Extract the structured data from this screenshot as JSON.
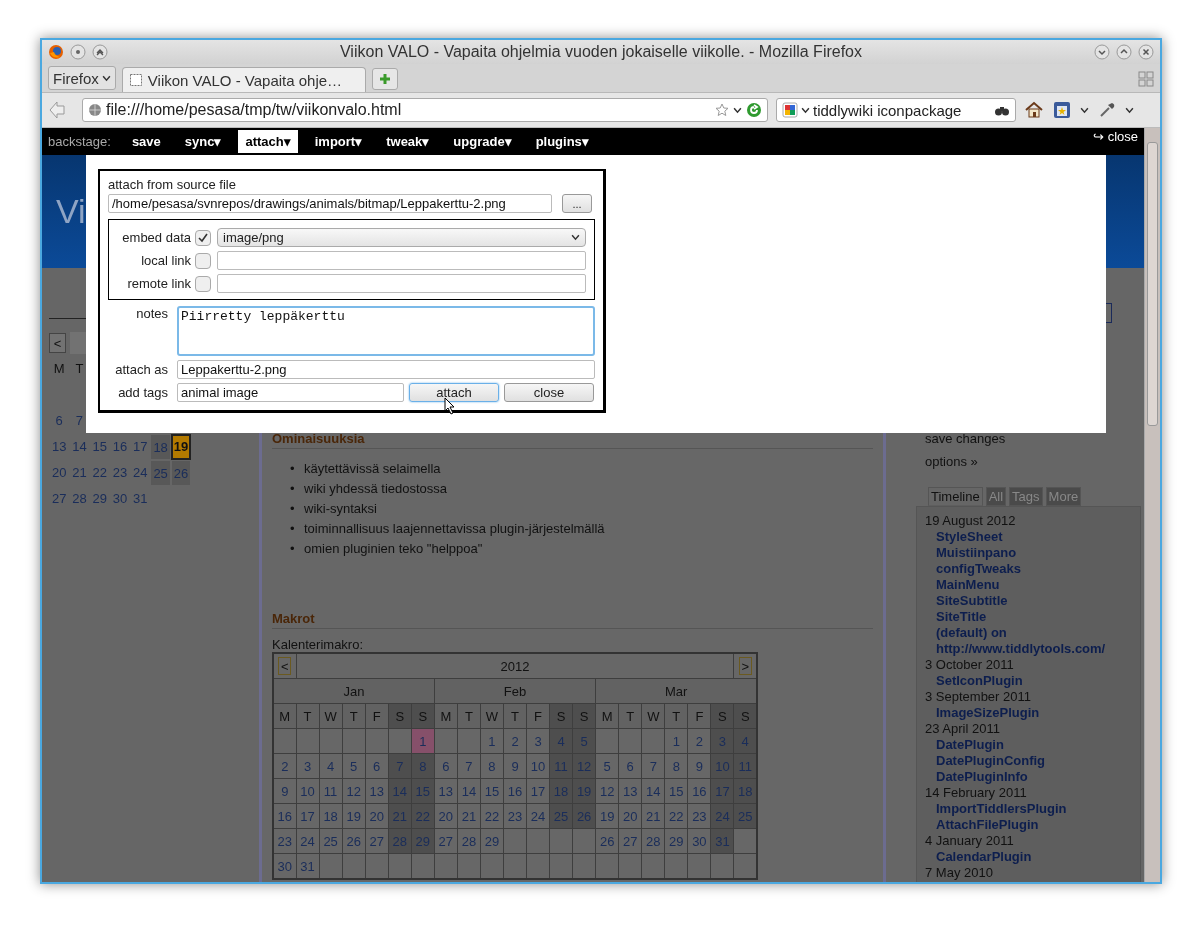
{
  "window": {
    "title": "Viikon VALO - Vapaita ohjelmia vuoden jokaiselle viikolle. - Mozilla Firefox"
  },
  "tab_bar": {
    "app_menu": "Firefox",
    "tabs": [
      {
        "title": "Viikon VALO - Vapaita ohje…",
        "selected": true
      }
    ]
  },
  "nav_bar": {
    "url": "file:///home/pesasa/tmp/tw/viikonvalo.html",
    "search": "tiddlywiki iconpackage"
  },
  "backstage": {
    "label": "backstage:",
    "items": [
      {
        "label": "save",
        "selected": false
      },
      {
        "label": "sync▾",
        "selected": false
      },
      {
        "label": "attach▾",
        "selected": true
      },
      {
        "label": "import▾",
        "selected": false
      },
      {
        "label": "tweak▾",
        "selected": false
      },
      {
        "label": "upgrade▾",
        "selected": false
      },
      {
        "label": "plugins▾",
        "selected": false
      }
    ],
    "close": "↪ close"
  },
  "site_title": "Vi",
  "mini_calendar": {
    "prev": "<",
    "weekdays": [
      "M",
      "T"
    ],
    "weeks": [
      [
        {
          "day": "6",
          "today": false
        },
        {
          "day": "7",
          "today": false
        }
      ],
      [
        {
          "day": "13",
          "today": false
        },
        {
          "day": "14",
          "today": false
        },
        {
          "day": "15",
          "today": false
        },
        {
          "day": "16",
          "today": false
        },
        {
          "day": "17",
          "today": false
        },
        {
          "day": "18",
          "today": false
        },
        {
          "day": "19",
          "today": true
        }
      ],
      [
        {
          "day": "20",
          "today": false
        },
        {
          "day": "21",
          "today": false
        },
        {
          "day": "22",
          "today": false
        },
        {
          "day": "23",
          "today": false
        },
        {
          "day": "24",
          "today": false
        },
        {
          "day": "25",
          "today": false
        },
        {
          "day": "26",
          "today": false
        }
      ],
      [
        {
          "day": "27",
          "today": false
        },
        {
          "day": "28",
          "today": false
        },
        {
          "day": "29",
          "today": false
        },
        {
          "day": "30",
          "today": false
        },
        {
          "day": "31",
          "today": false
        }
      ]
    ]
  },
  "story": {
    "heading": "Ominaisuuksia",
    "bullet": "•",
    "features": [
      "käytettävissä selaimella",
      "wiki yhdessä tiedostossa",
      "wiki-syntaksi",
      "toiminnallisuus laajennettavissa plugin-järjestelmällä",
      "omien pluginien teko \"helppoa\""
    ],
    "macros_heading": "Makrot",
    "macro_label": "Kalenterimakro:",
    "calendar": {
      "prev": "<",
      "year": "2012",
      "next": ">",
      "months": [
        {
          "name": "Jan",
          "weekdays": [
            "M",
            "T",
            "W",
            "T",
            "F",
            "S",
            "S"
          ],
          "weeks": [
            [
              {
                "kind": "empty"
              },
              {
                "kind": "empty"
              },
              {
                "kind": "empty"
              },
              {
                "kind": "empty"
              },
              {
                "kind": "empty"
              },
              {
                "kind": "empty"
              },
              {
                "kind": "day",
                "day": "1",
                "holiday": true
              }
            ],
            [
              {
                "kind": "day",
                "day": "2",
                "holiday": false
              },
              {
                "kind": "day",
                "day": "3",
                "holiday": false
              },
              {
                "kind": "day",
                "day": "4",
                "holiday": false
              },
              {
                "kind": "day",
                "day": "5",
                "holiday": false
              },
              {
                "kind": "day",
                "day": "6",
                "holiday": false
              },
              {
                "kind": "day",
                "day": "7",
                "holiday": false
              },
              {
                "kind": "day",
                "day": "8",
                "holiday": false
              }
            ],
            [
              {
                "kind": "day",
                "day": "9",
                "holiday": false
              },
              {
                "kind": "day",
                "day": "10",
                "holiday": false
              },
              {
                "kind": "day",
                "day": "11",
                "holiday": false
              },
              {
                "kind": "day",
                "day": "12",
                "holiday": false
              },
              {
                "kind": "day",
                "day": "13",
                "holiday": false
              },
              {
                "kind": "day",
                "day": "14",
                "holiday": false
              },
              {
                "kind": "day",
                "day": "15",
                "holiday": false
              }
            ],
            [
              {
                "kind": "day",
                "day": "16",
                "holiday": false
              },
              {
                "kind": "day",
                "day": "17",
                "holiday": false
              },
              {
                "kind": "day",
                "day": "18",
                "holiday": false
              },
              {
                "kind": "day",
                "day": "19",
                "holiday": false
              },
              {
                "kind": "day",
                "day": "20",
                "holiday": false
              },
              {
                "kind": "day",
                "day": "21",
                "holiday": false
              },
              {
                "kind": "day",
                "day": "22",
                "holiday": false
              }
            ],
            [
              {
                "kind": "day",
                "day": "23",
                "holiday": false
              },
              {
                "kind": "day",
                "day": "24",
                "holiday": false
              },
              {
                "kind": "day",
                "day": "25",
                "holiday": false
              },
              {
                "kind": "day",
                "day": "26",
                "holiday": false
              },
              {
                "kind": "day",
                "day": "27",
                "holiday": false
              },
              {
                "kind": "day",
                "day": "28",
                "holiday": false
              },
              {
                "kind": "day",
                "day": "29",
                "holiday": false
              }
            ],
            [
              {
                "kind": "day",
                "day": "30",
                "holiday": false
              },
              {
                "kind": "day",
                "day": "31",
                "holiday": false
              },
              {
                "kind": "empty"
              },
              {
                "kind": "empty"
              },
              {
                "kind": "empty"
              },
              {
                "kind": "empty"
              },
              {
                "kind": "empty"
              }
            ]
          ]
        },
        {
          "name": "Feb",
          "weekdays": [
            "M",
            "T",
            "W",
            "T",
            "F",
            "S",
            "S"
          ],
          "weeks": [
            [
              {
                "kind": "empty"
              },
              {
                "kind": "empty"
              },
              {
                "kind": "day",
                "day": "1",
                "holiday": false
              },
              {
                "kind": "day",
                "day": "2",
                "holiday": false
              },
              {
                "kind": "day",
                "day": "3",
                "holiday": false
              },
              {
                "kind": "day",
                "day": "4",
                "holiday": false
              },
              {
                "kind": "day",
                "day": "5",
                "holiday": false
              }
            ],
            [
              {
                "kind": "day",
                "day": "6",
                "holiday": false
              },
              {
                "kind": "day",
                "day": "7",
                "holiday": false
              },
              {
                "kind": "day",
                "day": "8",
                "holiday": false
              },
              {
                "kind": "day",
                "day": "9",
                "holiday": false
              },
              {
                "kind": "day",
                "day": "10",
                "holiday": false
              },
              {
                "kind": "day",
                "day": "11",
                "holiday": false
              },
              {
                "kind": "day",
                "day": "12",
                "holiday": false
              }
            ],
            [
              {
                "kind": "day",
                "day": "13",
                "holiday": false
              },
              {
                "kind": "day",
                "day": "14",
                "holiday": false
              },
              {
                "kind": "day",
                "day": "15",
                "holiday": false
              },
              {
                "kind": "day",
                "day": "16",
                "holiday": false
              },
              {
                "kind": "day",
                "day": "17",
                "holiday": false
              },
              {
                "kind": "day",
                "day": "18",
                "holiday": false
              },
              {
                "kind": "day",
                "day": "19",
                "holiday": false
              }
            ],
            [
              {
                "kind": "day",
                "day": "20",
                "holiday": false
              },
              {
                "kind": "day",
                "day": "21",
                "holiday": false
              },
              {
                "kind": "day",
                "day": "22",
                "holiday": false
              },
              {
                "kind": "day",
                "day": "23",
                "holiday": false
              },
              {
                "kind": "day",
                "day": "24",
                "holiday": false
              },
              {
                "kind": "day",
                "day": "25",
                "holiday": false
              },
              {
                "kind": "day",
                "day": "26",
                "holiday": false
              }
            ],
            [
              {
                "kind": "day",
                "day": "27",
                "holiday": false
              },
              {
                "kind": "day",
                "day": "28",
                "holiday": false
              },
              {
                "kind": "day",
                "day": "29",
                "holiday": false
              },
              {
                "kind": "empty"
              },
              {
                "kind": "empty"
              },
              {
                "kind": "empty"
              },
              {
                "kind": "empty"
              }
            ],
            [
              {
                "kind": "empty"
              },
              {
                "kind": "empty"
              },
              {
                "kind": "empty"
              },
              {
                "kind": "empty"
              },
              {
                "kind": "empty"
              },
              {
                "kind": "empty"
              },
              {
                "kind": "empty"
              }
            ]
          ]
        },
        {
          "name": "Mar",
          "weekdays": [
            "M",
            "T",
            "W",
            "T",
            "F",
            "S",
            "S"
          ],
          "weeks": [
            [
              {
                "kind": "empty"
              },
              {
                "kind": "empty"
              },
              {
                "kind": "empty"
              },
              {
                "kind": "day",
                "day": "1",
                "holiday": false
              },
              {
                "kind": "day",
                "day": "2",
                "holiday": false
              },
              {
                "kind": "day",
                "day": "3",
                "holiday": false
              },
              {
                "kind": "day",
                "day": "4",
                "holiday": false
              }
            ],
            [
              {
                "kind": "day",
                "day": "5",
                "holiday": false
              },
              {
                "kind": "day",
                "day": "6",
                "holiday": false
              },
              {
                "kind": "day",
                "day": "7",
                "holiday": false
              },
              {
                "kind": "day",
                "day": "8",
                "holiday": false
              },
              {
                "kind": "day",
                "day": "9",
                "holiday": false
              },
              {
                "kind": "day",
                "day": "10",
                "holiday": false
              },
              {
                "kind": "day",
                "day": "11",
                "holiday": false
              }
            ],
            [
              {
                "kind": "day",
                "day": "12",
                "holiday": false
              },
              {
                "kind": "day",
                "day": "13",
                "holiday": false
              },
              {
                "kind": "day",
                "day": "14",
                "holiday": false
              },
              {
                "kind": "day",
                "day": "15",
                "holiday": false
              },
              {
                "kind": "day",
                "day": "16",
                "holiday": false
              },
              {
                "kind": "day",
                "day": "17",
                "holiday": false
              },
              {
                "kind": "day",
                "day": "18",
                "holiday": false
              }
            ],
            [
              {
                "kind": "day",
                "day": "19",
                "holiday": false
              },
              {
                "kind": "day",
                "day": "20",
                "holiday": false
              },
              {
                "kind": "day",
                "day": "21",
                "holiday": false
              },
              {
                "kind": "day",
                "day": "22",
                "holiday": false
              },
              {
                "kind": "day",
                "day": "23",
                "holiday": false
              },
              {
                "kind": "day",
                "day": "24",
                "holiday": false
              },
              {
                "kind": "day",
                "day": "25",
                "holiday": false
              }
            ],
            [
              {
                "kind": "day",
                "day": "26",
                "holiday": false
              },
              {
                "kind": "day",
                "day": "27",
                "holiday": false
              },
              {
                "kind": "day",
                "day": "28",
                "holiday": false
              },
              {
                "kind": "day",
                "day": "29",
                "holiday": false
              },
              {
                "kind": "day",
                "day": "30",
                "holiday": false
              },
              {
                "kind": "day",
                "day": "31",
                "holiday": false
              },
              {
                "kind": "empty"
              }
            ],
            [
              {
                "kind": "empty"
              },
              {
                "kind": "empty"
              },
              {
                "kind": "empty"
              },
              {
                "kind": "empty"
              },
              {
                "kind": "empty"
              },
              {
                "kind": "empty"
              },
              {
                "kind": "empty"
              }
            ]
          ]
        }
      ]
    }
  },
  "sidebar": {
    "menu": [
      "save changes",
      "options »"
    ],
    "tabs": [
      {
        "label": "Timeline",
        "selected": true
      },
      {
        "label": "All",
        "selected": false
      },
      {
        "label": "Tags",
        "selected": false
      },
      {
        "label": "More",
        "selected": false
      }
    ],
    "timeline": [
      {
        "date": "19 August 2012",
        "items": [
          "StyleSheet",
          "Muistiinpano",
          "configTweaks",
          "MainMenu",
          "SiteSubtitle",
          "SiteTitle",
          "(default) on http://www.tiddlytools.com/"
        ]
      },
      {
        "date": "3 October 2011",
        "items": [
          "SetIconPlugin"
        ]
      },
      {
        "date": "3 September 2011",
        "items": [
          "ImageSizePlugin"
        ]
      },
      {
        "date": "23 April 2011",
        "items": [
          "DatePlugin",
          "DatePluginConfig",
          "DatePluginInfo"
        ]
      },
      {
        "date": "14 February 2011",
        "items": [
          "ImportTiddlersPlugin",
          "AttachFilePlugin"
        ]
      },
      {
        "date": "4 January 2011",
        "items": [
          "CalendarPlugin"
        ]
      },
      {
        "date": "7 May 2010"
      }
    ]
  },
  "dialog": {
    "source_label": "attach from source file",
    "source_path": "/home/pesasa/svnrepos/drawings/animals/bitmap/Leppakerttu-2.png",
    "browse": "...",
    "options": [
      {
        "kind": "select",
        "label": "embed data",
        "checked": true,
        "value": "image/png"
      },
      {
        "kind": "text",
        "label": "local link",
        "checked": false
      },
      {
        "kind": "text",
        "label": "remote link",
        "checked": false
      }
    ],
    "notes_label": "notes",
    "notes": "Piirretty leppäkerttu",
    "attach_as_label": "attach as",
    "attach_as": "Leppakerttu-2.png",
    "tags_label": "add tags",
    "tags": "animal image",
    "buttons": [
      {
        "label": "attach",
        "focused": true
      },
      {
        "label": "close",
        "focused": false
      }
    ]
  }
}
